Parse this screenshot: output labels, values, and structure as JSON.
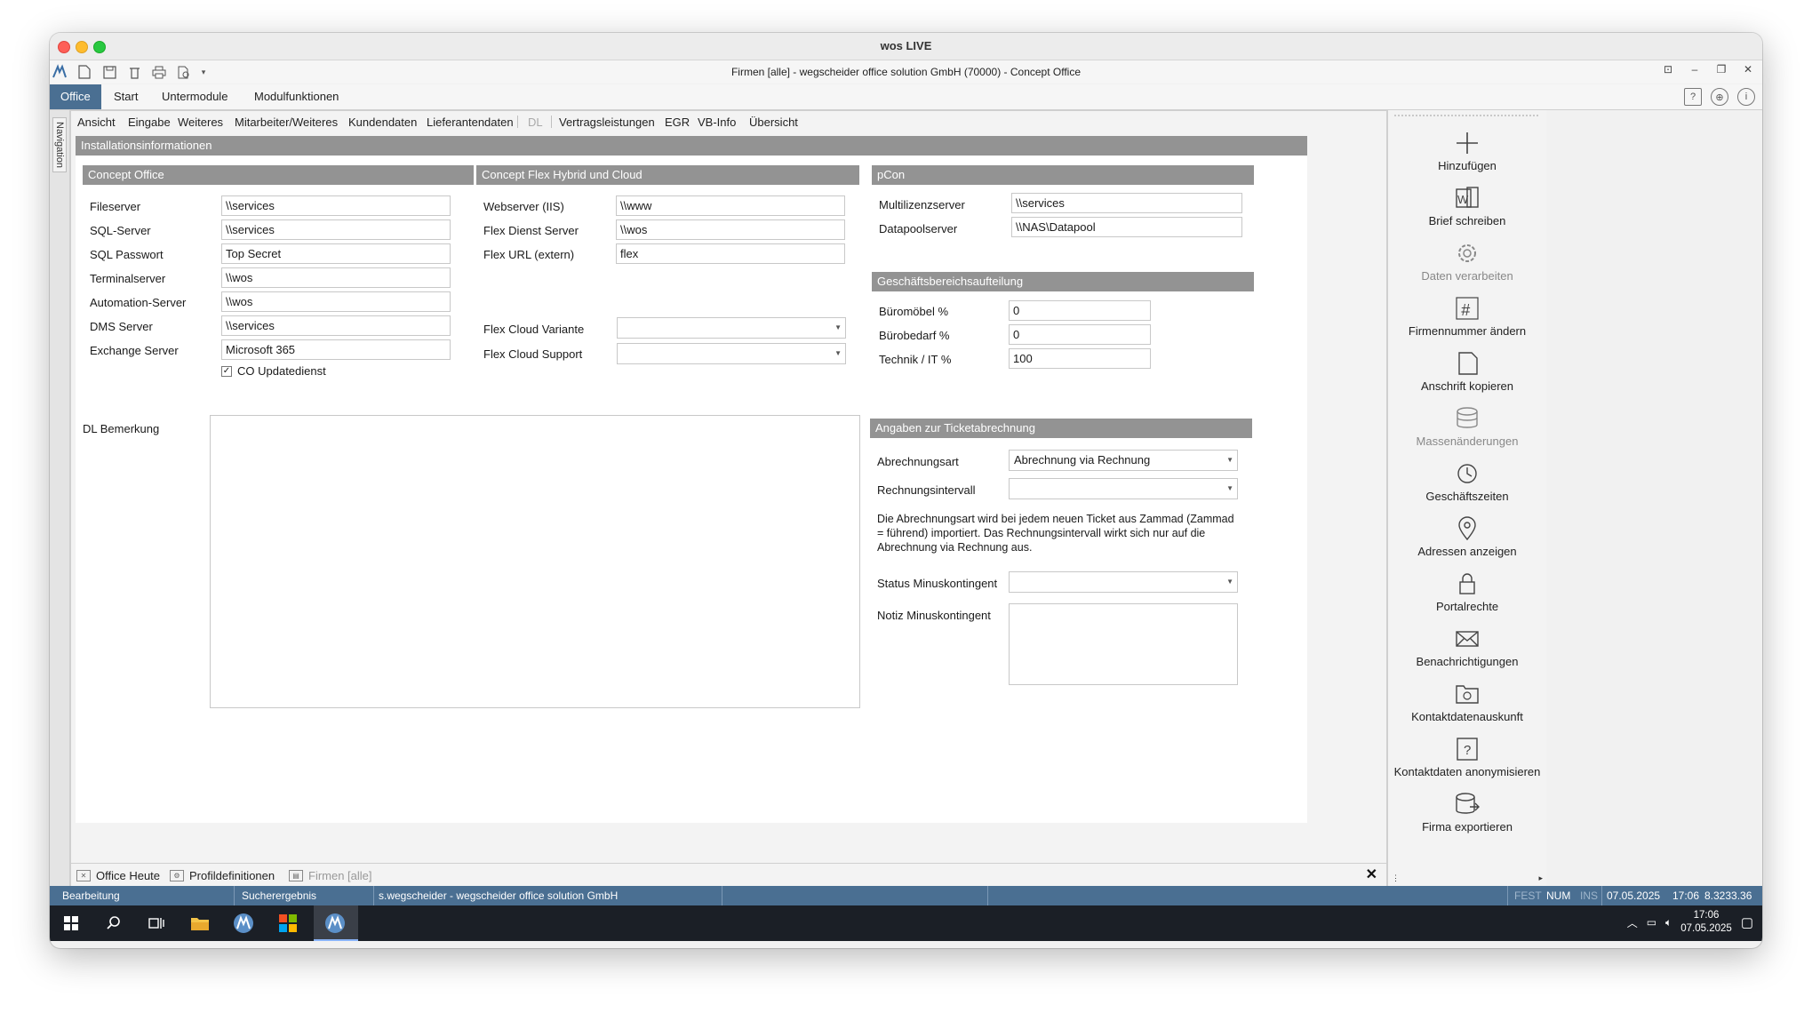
{
  "window": {
    "title": "wos LIVE"
  },
  "app": {
    "title": "Firmen [alle] - wegscheider office solution GmbH (70000) - Concept Office"
  },
  "ribbon": {
    "tabs": [
      "Office",
      "Start",
      "Untermodule",
      "Modulfunktionen"
    ]
  },
  "nav": {
    "label": "Navigation"
  },
  "subtabs": [
    "Ansicht",
    "Eingabe",
    "Weiteres",
    "Mitarbeiter/Weiteres",
    "Kundendaten",
    "Lieferantendaten",
    "DL",
    "Vertragsleistungen",
    "EGR",
    "VB-Info",
    "Übersicht"
  ],
  "section": {
    "title": "Installationsinformationen"
  },
  "concept_office": {
    "title": "Concept Office",
    "fields": [
      {
        "label": "Fileserver",
        "value": "\\\\services"
      },
      {
        "label": "SQL-Server",
        "value": "\\\\services"
      },
      {
        "label": "SQL Passwort",
        "value": "Top Secret"
      },
      {
        "label": "Terminalserver",
        "value": "\\\\wos"
      },
      {
        "label": "Automation-Server",
        "value": "\\\\wos"
      },
      {
        "label": "DMS Server",
        "value": "\\\\services"
      },
      {
        "label": "Exchange Server",
        "value": "Microsoft 365"
      }
    ],
    "checkbox_label": "CO Updatedienst",
    "checkbox_checked": true
  },
  "flex": {
    "title": "Concept Flex Hybrid und Cloud",
    "fields": [
      {
        "label": "Webserver (IIS)",
        "value": "\\\\www"
      },
      {
        "label": "Flex Dienst Server",
        "value": "\\\\wos"
      },
      {
        "label": "Flex URL (extern)",
        "value": "flex"
      }
    ],
    "variant_label": "Flex Cloud Variante",
    "variant_value": "",
    "support_label": "Flex Cloud Support",
    "support_value": ""
  },
  "pcon": {
    "title": "pCon",
    "fields": [
      {
        "label": "Multilizenzserver",
        "value": "\\\\services"
      },
      {
        "label": "Datapoolserver",
        "value": "\\\\NAS\\Datapool"
      }
    ]
  },
  "gb": {
    "title": "Geschäftsbereichsaufteilung",
    "fields": [
      {
        "label": "Büromöbel %",
        "value": "0"
      },
      {
        "label": "Bürobedarf %",
        "value": "0"
      },
      {
        "label": "Technik / IT %",
        "value": "100"
      }
    ]
  },
  "dl": {
    "label": "DL Bemerkung",
    "value": ""
  },
  "ticket": {
    "title": "Angaben zur Ticketabrechnung",
    "art_label": "Abrechnungsart",
    "art_value": "Abrechnung via Rechnung",
    "intervall_label": "Rechnungsintervall",
    "intervall_value": "",
    "note": "Die Abrechnungsart wird bei jedem neuen Ticket aus Zammad (Zammad = führend) importiert. Das Rechnungsintervall wirkt sich nur auf die Abrechnung via Rechnung aus.",
    "status_label": "Status Minuskontingent",
    "status_value": "",
    "notiz_label": "Notiz Minuskontingent",
    "notiz_value": ""
  },
  "bottom_tabs": [
    "Office Heute",
    "Profildefinitionen",
    "Firmen [alle]"
  ],
  "actions": [
    {
      "label": "Hinzufügen",
      "icon": "plus-icon",
      "enabled": true
    },
    {
      "label": "Brief schreiben",
      "icon": "word-icon",
      "enabled": true
    },
    {
      "label": "Daten verarbeiten",
      "icon": "gear-icon",
      "enabled": false
    },
    {
      "label": "Firmennummer ändern",
      "icon": "hash-icon",
      "enabled": true
    },
    {
      "label": "Anschrift kopieren",
      "icon": "copy-icon",
      "enabled": true
    },
    {
      "label": "Massenänderungen",
      "icon": "database-icon",
      "enabled": false
    },
    {
      "label": "Geschäftszeiten",
      "icon": "clock-icon",
      "enabled": true
    },
    {
      "label": "Adressen anzeigen",
      "icon": "map-pin-icon",
      "enabled": true
    },
    {
      "label": "Portalrechte",
      "icon": "lock-icon",
      "enabled": true
    },
    {
      "label": "Benachrichtigungen",
      "icon": "mail-icon",
      "enabled": true
    },
    {
      "label": "Kontaktdatenauskunft",
      "icon": "folder-info-icon",
      "enabled": true
    },
    {
      "label": "Kontaktdaten anonymisieren",
      "icon": "question-icon",
      "enabled": true
    },
    {
      "label": "Firma exportieren",
      "icon": "export-icon",
      "enabled": true
    }
  ],
  "status": {
    "mode": "Bearbeitung",
    "search": "Sucherergebnis",
    "user": "s.wegscheider - wegscheider office solution GmbH",
    "fest": "FEST",
    "num": "NUM",
    "ins": "INS",
    "date": "07.05.2025",
    "time": "17:06",
    "version": "8.3233.36"
  },
  "taskbar": {
    "time": "17:06",
    "date": "07.05.2025"
  },
  "colors": {
    "accent": "#4a6f92",
    "section_bar": "#939393"
  }
}
